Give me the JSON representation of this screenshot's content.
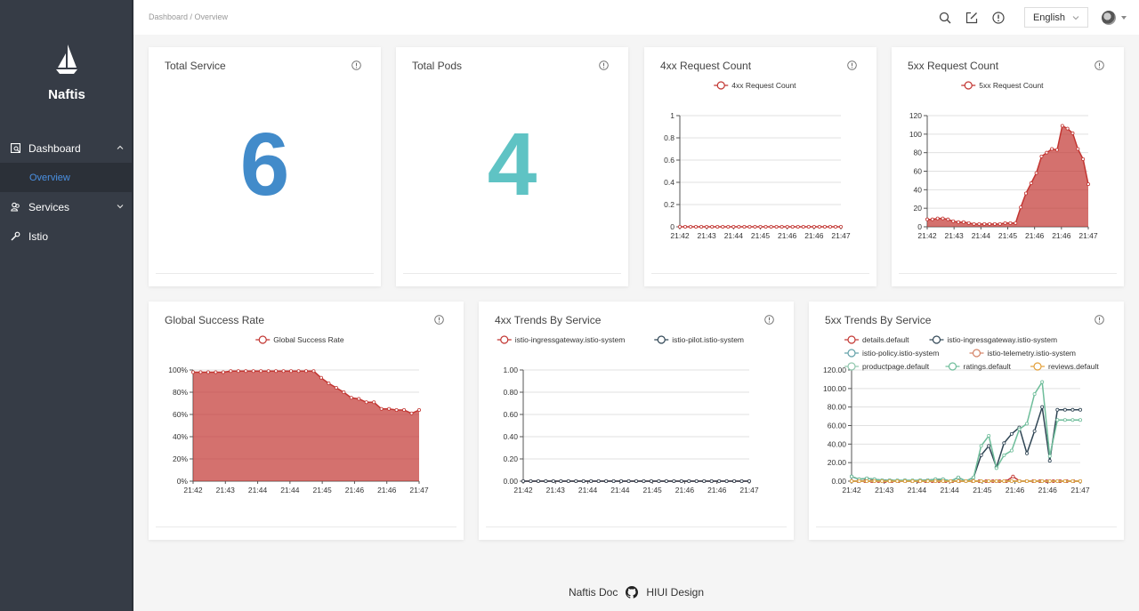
{
  "app": {
    "name": "Naftis"
  },
  "sidebar": {
    "items": [
      {
        "label": "Dashboard",
        "icon": "dashboard-icon",
        "expanded": true,
        "children": [
          {
            "label": "Overview",
            "active": true
          }
        ]
      },
      {
        "label": "Services",
        "icon": "services-icon",
        "expanded": false
      },
      {
        "label": "Istio",
        "icon": "istio-wrench-icon"
      }
    ]
  },
  "header": {
    "breadcrumb": "Dashboard / Overview",
    "icons": [
      "search-icon",
      "edit-icon",
      "info-icon"
    ],
    "language": "English"
  },
  "cards": {
    "total_service": {
      "title": "Total Service",
      "value": "6",
      "color": "#428bca"
    },
    "total_pods": {
      "title": "Total Pods",
      "value": "4",
      "color": "#5fc3c4"
    },
    "req_4xx": {
      "title": "4xx Request Count"
    },
    "req_5xx": {
      "title": "5xx Request Count"
    },
    "success_rate": {
      "title": "Global Success Rate"
    },
    "trends_4xx": {
      "title": "4xx Trends By Service"
    },
    "trends_5xx": {
      "title": "5xx Trends By Service"
    }
  },
  "footer": {
    "doc_link": "Naftis Doc",
    "design_link": "HIUI Design"
  },
  "chart_data": [
    {
      "id": "req_4xx",
      "type": "line",
      "title": "4xx Request Count",
      "x_tick_labels": [
        "21:42",
        "21:43",
        "21:44",
        "21:45",
        "21:46",
        "21:46",
        "21:47"
      ],
      "ylim": [
        0,
        1
      ],
      "y_ticks": [
        "0",
        "0.2",
        "0.4",
        "0.6",
        "0.8",
        "1"
      ],
      "grid": true,
      "legend": "top-center",
      "series": [
        {
          "name": "4xx Request Count",
          "color": "#c23531",
          "values": [
            0,
            0,
            0,
            0,
            0,
            0,
            0,
            0,
            0,
            0,
            0,
            0,
            0,
            0,
            0,
            0,
            0,
            0,
            0,
            0,
            0,
            0,
            0,
            0,
            0,
            0,
            0,
            0,
            0,
            0,
            0
          ]
        }
      ]
    },
    {
      "id": "req_5xx",
      "type": "area",
      "title": "5xx Request Count",
      "x_tick_labels": [
        "21:42",
        "21:43",
        "21:44",
        "21:45",
        "21:46",
        "21:46",
        "21:47"
      ],
      "ylim": [
        0,
        120
      ],
      "y_ticks": [
        "0",
        "20",
        "40",
        "60",
        "80",
        "100",
        "120"
      ],
      "grid": true,
      "legend": "top-center",
      "series": [
        {
          "name": "5xx Request Count",
          "color": "#c23531",
          "values": [
            8,
            8,
            9,
            9,
            8,
            6,
            5,
            5,
            4,
            3,
            3,
            3,
            3,
            3,
            3,
            4,
            4,
            4,
            21,
            36,
            47,
            58,
            76,
            80,
            84,
            83,
            109,
            106,
            101,
            84,
            73,
            46
          ]
        }
      ]
    },
    {
      "id": "success_rate",
      "type": "area",
      "title": "Global Success Rate",
      "x_tick_labels": [
        "21:42",
        "21:43",
        "21:44",
        "21:44",
        "21:45",
        "21:46",
        "21:46",
        "21:47"
      ],
      "ylim": [
        0,
        100
      ],
      "y_ticks": [
        "0%",
        "20%",
        "40%",
        "60%",
        "80%",
        "100%"
      ],
      "grid": true,
      "legend": "top-center",
      "series": [
        {
          "name": "Global Success Rate",
          "color": "#c23531",
          "values": [
            98,
            98,
            98,
            98,
            98,
            99,
            99,
            99,
            99,
            99,
            99,
            99,
            99,
            99,
            99,
            99,
            99,
            93,
            88,
            84,
            80,
            75,
            74,
            71,
            71,
            65,
            65,
            64,
            64,
            61,
            64
          ]
        }
      ]
    },
    {
      "id": "trends_4xx",
      "type": "line",
      "title": "4xx Trends By Service",
      "x_tick_labels": [
        "21:42",
        "21:43",
        "21:44",
        "21:44",
        "21:45",
        "21:46",
        "21:46",
        "21:47"
      ],
      "ylim": [
        0,
        1
      ],
      "y_ticks": [
        "0.00",
        "0.20",
        "0.40",
        "0.60",
        "0.80",
        "1.00"
      ],
      "grid": true,
      "legend": "top-center",
      "series": [
        {
          "name": "istio-ingressgateway.istio-system",
          "color": "#c23531",
          "values": [
            0,
            0,
            0,
            0,
            0,
            0,
            0,
            0,
            0,
            0,
            0,
            0,
            0,
            0,
            0,
            0,
            0,
            0,
            0,
            0,
            0,
            0,
            0,
            0,
            0,
            0,
            0,
            0,
            0,
            0,
            0
          ]
        },
        {
          "name": "istio-pilot.istio-system",
          "color": "#2f4554",
          "values": [
            0,
            0,
            0,
            0,
            0,
            0,
            0,
            0,
            0,
            0,
            0,
            0,
            0,
            0,
            0,
            0,
            0,
            0,
            0,
            0,
            0,
            0,
            0,
            0,
            0,
            0,
            0,
            0,
            0,
            0,
            0
          ]
        }
      ]
    },
    {
      "id": "trends_5xx",
      "type": "line",
      "title": "5xx Trends By Service",
      "x_tick_labels": [
        "21:42",
        "21:43",
        "21:44",
        "21:44",
        "21:45",
        "21:46",
        "21:46",
        "21:47"
      ],
      "ylim": [
        0,
        120
      ],
      "y_ticks": [
        "0.00",
        "20.00",
        "40.00",
        "60.00",
        "80.00",
        "100.00",
        "120.00"
      ],
      "grid": true,
      "legend": "top-left",
      "series": [
        {
          "name": "details.default",
          "color": "#c23531",
          "values": [
            0,
            0,
            0,
            0,
            0,
            0,
            0,
            0,
            0,
            0,
            0,
            0,
            0,
            0,
            0,
            0,
            0,
            0,
            0,
            0,
            0,
            0,
            0,
            0,
            5,
            0,
            0,
            0,
            0,
            0,
            0,
            0,
            0,
            0,
            0
          ]
        },
        {
          "name": "istio-ingressgateway.istio-system",
          "color": "#2f4554",
          "values": [
            5,
            2,
            3,
            2,
            1,
            1,
            0,
            1,
            0,
            1,
            1,
            2,
            2,
            0,
            4,
            0,
            4,
            28,
            38,
            15,
            41,
            51,
            58,
            30,
            54,
            80,
            22,
            77,
            77,
            77,
            77
          ]
        },
        {
          "name": "istio-policy.istio-system",
          "color": "#61a0a8",
          "values": [
            0,
            0,
            0,
            0,
            0,
            0,
            0,
            0,
            0,
            0,
            0,
            0,
            0,
            0,
            0,
            0,
            0,
            0,
            0,
            0,
            0,
            0,
            0,
            0,
            0,
            0,
            0,
            0,
            0,
            0,
            0
          ]
        },
        {
          "name": "istio-telemetry.istio-system",
          "color": "#d48265",
          "values": [
            0,
            0,
            0,
            0,
            0,
            0,
            0,
            0,
            0,
            0,
            0,
            0,
            0,
            0,
            0,
            0,
            0,
            0,
            0,
            0,
            0,
            0,
            0,
            0,
            0,
            0,
            0,
            0,
            0,
            0,
            0
          ]
        },
        {
          "name": "productpage.default",
          "color": "#91c7ae",
          "values": [
            0,
            0,
            0,
            0,
            0,
            0,
            0,
            0,
            0,
            0,
            0,
            0,
            0,
            0,
            0,
            0,
            0,
            0,
            0,
            0,
            0,
            0,
            0,
            0,
            0,
            0,
            0,
            0,
            0,
            0,
            0
          ]
        },
        {
          "name": "ratings.default",
          "color": "#6ebd9a",
          "values": [
            5,
            2,
            3,
            2,
            1,
            1,
            1,
            1,
            1,
            1,
            1,
            2,
            2,
            0,
            4,
            0,
            4,
            38,
            49,
            14,
            28,
            33,
            56,
            62,
            94,
            107,
            27,
            66,
            66,
            66,
            66
          ]
        },
        {
          "name": "reviews.default",
          "color": "#e3a03a",
          "values": [
            0,
            0,
            0,
            0,
            0,
            0,
            0,
            0,
            0,
            0,
            0,
            0,
            0,
            0,
            0,
            0,
            0,
            0,
            0,
            0,
            0,
            0,
            0,
            0,
            0,
            0,
            0,
            0,
            0,
            0,
            0
          ]
        }
      ]
    }
  ]
}
